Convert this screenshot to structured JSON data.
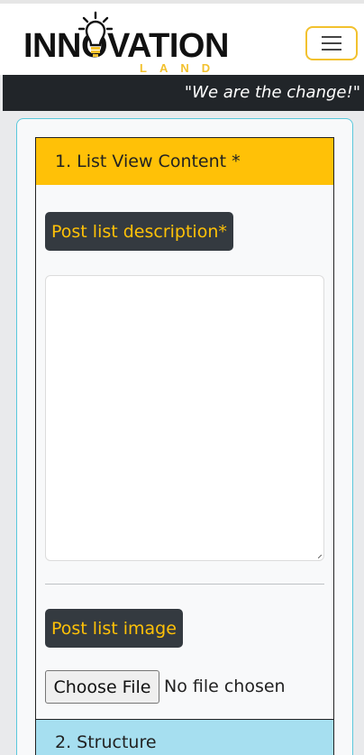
{
  "header": {
    "logo_word": "INNOVATION",
    "logo_sub": "LAND",
    "menu_label": "menu-icon",
    "tagline": "\"We are the change!\""
  },
  "section1": {
    "title": "1. List View Content *",
    "description_label": "Post list description*",
    "description_value": "",
    "image_label": "Post list image",
    "file_button": "Choose File",
    "file_status": "No file chosen"
  },
  "section2": {
    "title": "2. Structure"
  },
  "colors": {
    "accent_yellow": "#ffc107",
    "dark": "#212529",
    "pill_dark": "#343a40",
    "section2_blue": "#a6dff0",
    "card_border": "#5ac8dc"
  }
}
